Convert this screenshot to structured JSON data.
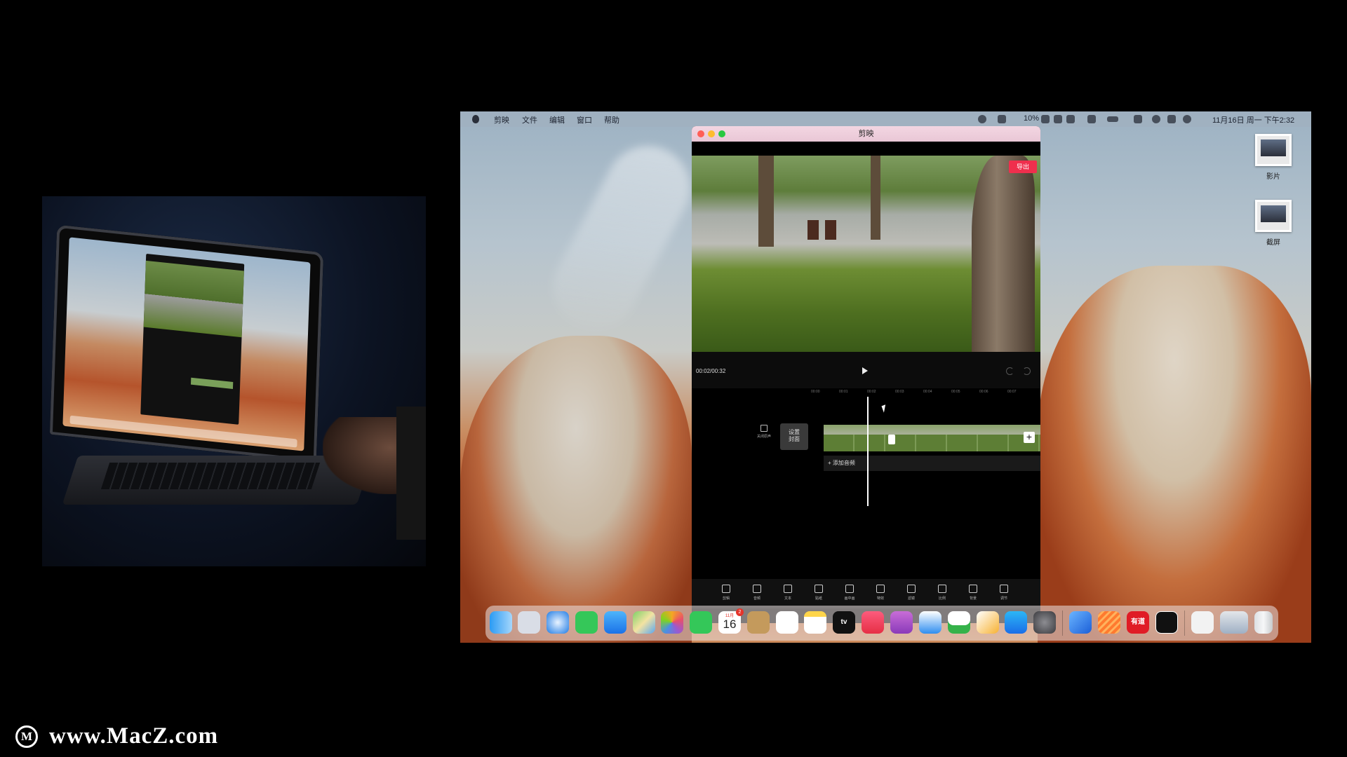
{
  "menubar": {
    "items": [
      "剪映",
      "文件",
      "编辑",
      "窗口",
      "帮助"
    ],
    "battery_text": "10%",
    "datetime": "11月16日 周一 下午2:32"
  },
  "desktop": {
    "icons": [
      {
        "label": "影片",
        "icon": "movie-file-icon"
      },
      {
        "label": "截屏",
        "icon": "screenshot-file-icon"
      }
    ]
  },
  "app": {
    "title": "剪映",
    "export_label": "导出",
    "timecode": "00:02/00:32",
    "ruler_ticks": [
      "00:00",
      "00:01",
      "00:02",
      "00:03",
      "00:04",
      "00:05",
      "00:06",
      "00:07"
    ],
    "mute_label": "关闭原声",
    "cover_label_1": "设置",
    "cover_label_2": "封面",
    "add_audio_label": "+ 添加音频",
    "toolbar": [
      "剪辑",
      "音频",
      "文本",
      "贴纸",
      "画中画",
      "特效",
      "滤镜",
      "比例",
      "背景",
      "调节"
    ]
  },
  "dock": {
    "calendar_month": "11月",
    "calendar_day": "16",
    "calendar_badge": "2",
    "tv_label": "tv",
    "youdao_label": "有道",
    "items": [
      "finder-icon",
      "launchpad-icon",
      "safari-icon",
      "messages-icon",
      "mail-icon",
      "maps-icon",
      "photos-icon",
      "facetime-icon",
      "calendar-icon",
      "contacts-icon",
      "reminders-icon",
      "notes-icon",
      "tv-icon",
      "music-icon",
      "podcasts-icon",
      "keynote-icon",
      "numbers-icon",
      "pages-icon",
      "app-store-icon",
      "system-preferences-icon",
      "xcode-icon",
      "sublime-icon",
      "youdao-icon",
      "capcut-icon",
      "music-file-icon",
      "screenshot-stack-icon",
      "trash-icon"
    ]
  },
  "watermark": {
    "text": "www.MacZ.com"
  },
  "colors": {
    "export_red": "#ef2f4d",
    "titlebar_pink": "#f3d6e2",
    "close": "#ff5f57",
    "minimize": "#febc2e",
    "zoom": "#28c840"
  }
}
